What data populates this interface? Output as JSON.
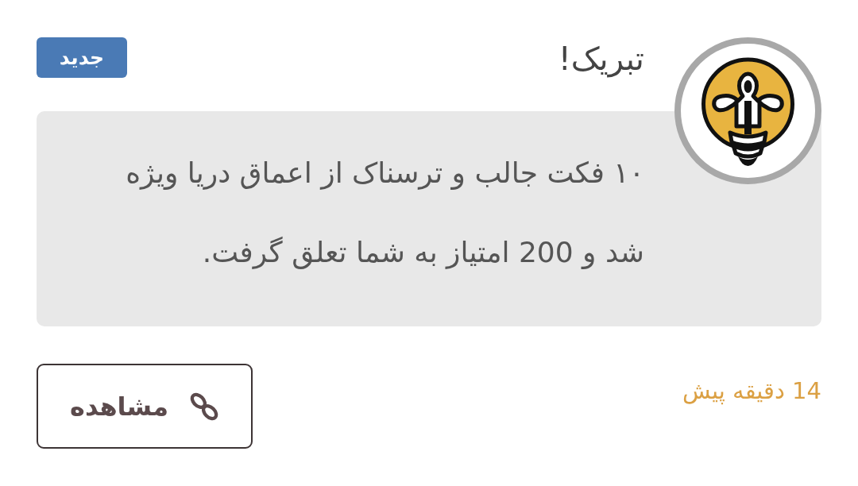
{
  "notification": {
    "title": "تبریک!",
    "badge": "جدید",
    "message": "۱۰ فکت جالب و ترسناک از اعماق دریا ویژه شد و 200 امتیاز به شما تعلق گرفت.",
    "time": "14 دقیقه پیش",
    "action": {
      "label": "مشاهده"
    }
  }
}
